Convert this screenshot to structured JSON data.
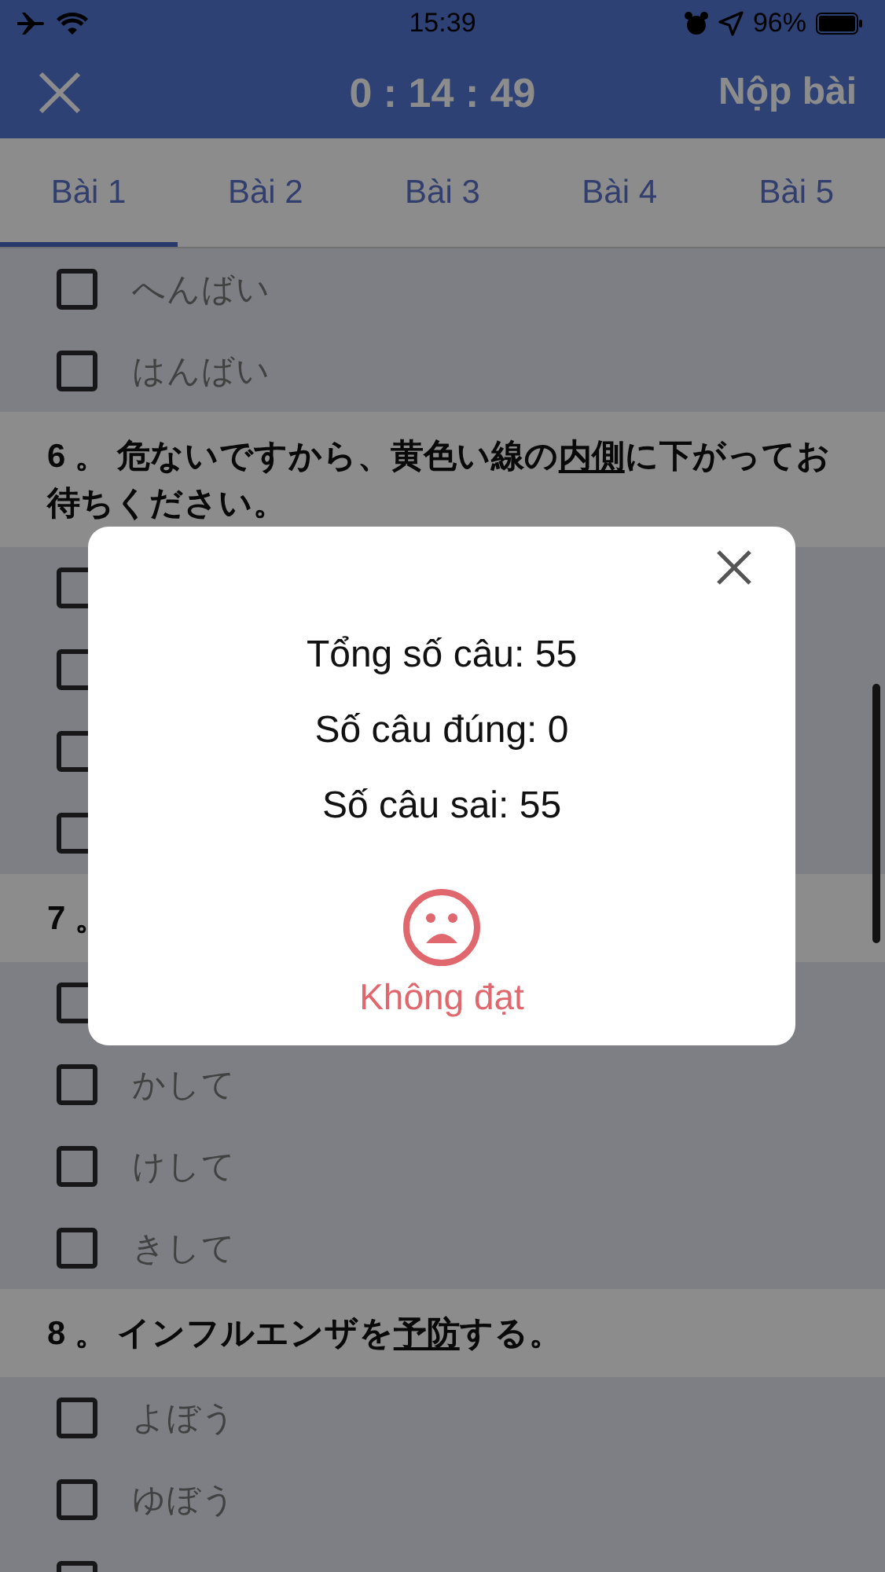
{
  "status_bar": {
    "time": "15:39",
    "battery": "96%"
  },
  "header": {
    "timer": "0 : 14 : 49",
    "submit": "Nộp bài"
  },
  "tabs": [
    {
      "label": "Bài 1",
      "selected": true
    },
    {
      "label": "Bài 2",
      "selected": false
    },
    {
      "label": "Bài 3",
      "selected": false
    },
    {
      "label": "Bài 4",
      "selected": false
    },
    {
      "label": "Bài 5",
      "selected": false
    }
  ],
  "questions": [
    {
      "options": [
        {
          "text": "へんばい",
          "checked": false
        },
        {
          "text": "はんばい",
          "checked": false
        }
      ]
    },
    {
      "number": "6 。",
      "parts": [
        {
          "text": "危ないですから、黄色い線の",
          "underlined": false
        },
        {
          "text": "内側",
          "underlined": true
        },
        {
          "text": "に下がってお待ちください。",
          "underlined": false
        }
      ],
      "options": [
        {
          "checked": false
        },
        {
          "checked": false
        },
        {
          "checked": false
        },
        {
          "checked": false
        }
      ]
    },
    {
      "number": "7 。",
      "options": [
        {
          "checked": false
        },
        {
          "text": "かして",
          "checked": false
        },
        {
          "text": "けして",
          "checked": false
        },
        {
          "text": "きして",
          "checked": false
        }
      ]
    },
    {
      "number": "8 。",
      "parts": [
        {
          "text": "インフルエンザを",
          "underlined": false
        },
        {
          "text": "予防",
          "underlined": true
        },
        {
          "text": "する。",
          "underlined": false
        }
      ],
      "options": [
        {
          "text": "よぼう",
          "checked": false
        },
        {
          "text": "ゆぼう",
          "checked": false
        },
        {
          "checked": false
        }
      ]
    }
  ],
  "dialog": {
    "lines": [
      "Tổng số câu: 55",
      "Số câu đúng: 0",
      "Số câu sai: 55"
    ],
    "verdict": "Không đạt",
    "passed": false
  }
}
